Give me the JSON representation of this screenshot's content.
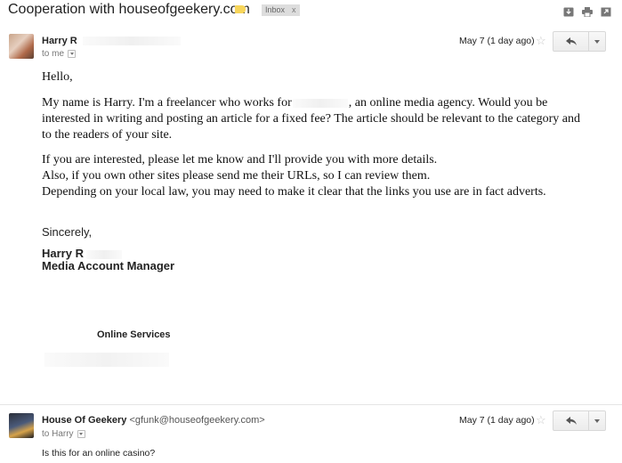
{
  "subject": {
    "title": "Cooperation with houseofgeekery.com",
    "label_chip": "Inbox",
    "chip_close": "x"
  },
  "message1": {
    "sender": "Harry R",
    "to": "to me",
    "date": "May 7 (1 day ago)",
    "greeting": "Hello,",
    "para1_a": "My name is Harry. I'm a freelancer who works for",
    "para1_b": ", an online media agency. Would you be",
    "para1_line2": "interested in writing and posting an article for a fixed fee? The article should be relevant to the category and",
    "para1_line3": "to the readers of your site.",
    "para2_line1": "If you are interested, please let me know and I'll provide you with more details.",
    "para2_line2": "Also, if you own other sites please send me their URLs, so I can review them.",
    "para2_line3": "Depending on your local law, you may need to make it clear that the links you use are in fact adverts.",
    "closing": "Sincerely,",
    "sig_name": "Harry R",
    "sig_title": "Media Account Manager",
    "company": "Online Services"
  },
  "message2": {
    "sender": "House Of Geekery",
    "sender_email": "<gfunk@houseofgeekery.com>",
    "to": "to Harry",
    "date": "May 7 (1 day ago)",
    "body": "Is this for an online casino?"
  },
  "icons": {
    "label": "label-tag-icon",
    "archive": "download-icon",
    "print": "print-icon",
    "new_window": "open-new-window-icon",
    "reply": "reply-icon",
    "star": "star-icon",
    "dropdown": "chevron-down-icon"
  },
  "colors": {
    "label_tag": "#f7d55a",
    "chip_bg": "#dddddd"
  }
}
